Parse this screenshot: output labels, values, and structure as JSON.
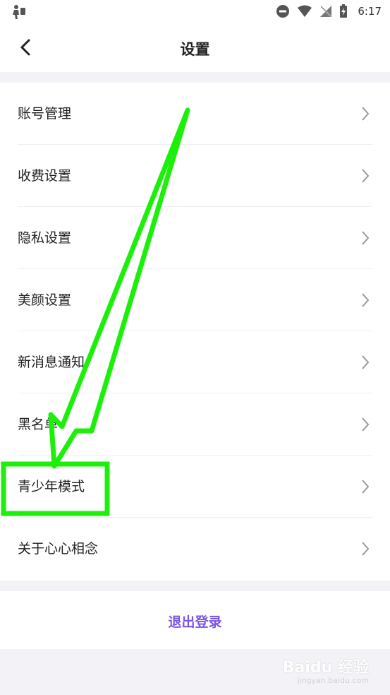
{
  "status_bar": {
    "time": "6:17",
    "icons": [
      "figure-icon",
      "dnd-icon",
      "wifi-icon",
      "no-signal-icon",
      "battery-charging-icon"
    ]
  },
  "header": {
    "title": "设置",
    "back_icon": "chevron-left-icon"
  },
  "settings": {
    "items": [
      {
        "label": "账号管理"
      },
      {
        "label": "收费设置"
      },
      {
        "label": "隐私设置"
      },
      {
        "label": "美颜设置"
      },
      {
        "label": "新消息通知"
      },
      {
        "label": "黑名单"
      },
      {
        "label": "青少年模式"
      },
      {
        "label": "关于心心相念"
      }
    ]
  },
  "logout": {
    "label": "退出登录",
    "color": "#7c55e6"
  },
  "annotation": {
    "color": "#1cf00a",
    "highlighted_item": "青少年模式"
  },
  "watermark": {
    "main": "Baidu 经验",
    "sub": "jingyan.baidu.com"
  }
}
